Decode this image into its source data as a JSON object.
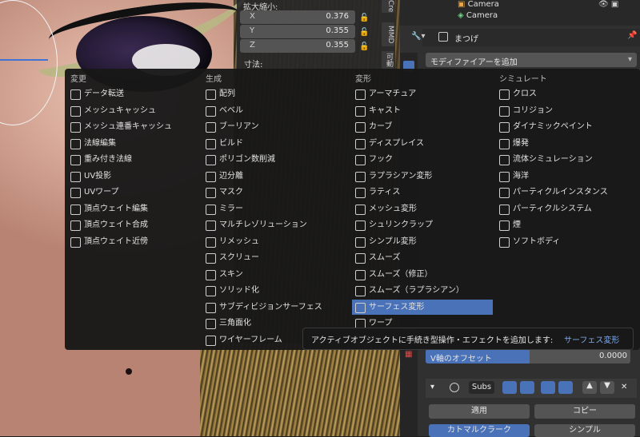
{
  "transform_panel": {
    "scale_label": "拡大縮小:",
    "dimensions_label": "寸法:",
    "scale": [
      {
        "axis": "X",
        "value": "0.376"
      },
      {
        "axis": "Y",
        "value": "0.355"
      },
      {
        "axis": "Z",
        "value": "0.355"
      }
    ],
    "side_tabs": [
      "Cre",
      "MMD",
      "可動"
    ]
  },
  "outliner": {
    "items": [
      "Camera",
      "Camera"
    ]
  },
  "properties": {
    "object_name": "まつげ",
    "add_modifier": "モディファイアーを追加",
    "v_offset_label": "V軸のオフセット",
    "v_offset_value": "0.0000",
    "modifier_name": "Subs",
    "apply_button": "適用",
    "copy_button": "コピー",
    "catmull_clark": "カトマルクラーク",
    "simple": "シンプル"
  },
  "menu": {
    "columns": [
      {
        "header": "変更",
        "items": [
          {
            "label": "データ転送",
            "icon": "data-transfer-icon"
          },
          {
            "label": "メッシュキャッシュ",
            "icon": "mesh-cache-icon"
          },
          {
            "label": "メッシュ連番キャッシュ",
            "icon": "mesh-sequence-cache-icon"
          },
          {
            "label": "法線編集",
            "icon": "normal-edit-icon"
          },
          {
            "label": "重み付き法線",
            "icon": "weighted-normal-icon"
          },
          {
            "label": "UV投影",
            "icon": "uv-project-icon"
          },
          {
            "label": "UVワープ",
            "icon": "uv-warp-icon"
          },
          {
            "label": "頂点ウェイト編集",
            "icon": "vertex-weight-edit-icon"
          },
          {
            "label": "頂点ウェイト合成",
            "icon": "vertex-weight-mix-icon"
          },
          {
            "label": "頂点ウェイト近傍",
            "icon": "vertex-weight-proximity-icon"
          }
        ]
      },
      {
        "header": "生成",
        "items": [
          {
            "label": "配列",
            "icon": "array-icon"
          },
          {
            "label": "ベベル",
            "icon": "bevel-icon"
          },
          {
            "label": "ブーリアン",
            "icon": "boolean-icon"
          },
          {
            "label": "ビルド",
            "icon": "build-icon"
          },
          {
            "label": "ポリゴン数削減",
            "icon": "decimate-icon"
          },
          {
            "label": "辺分離",
            "icon": "edge-split-icon"
          },
          {
            "label": "マスク",
            "icon": "mask-icon"
          },
          {
            "label": "ミラー",
            "icon": "mirror-icon"
          },
          {
            "label": "マルチレゾリューション",
            "icon": "multires-icon"
          },
          {
            "label": "リメッシュ",
            "icon": "remesh-icon"
          },
          {
            "label": "スクリュー",
            "icon": "screw-icon"
          },
          {
            "label": "スキン",
            "icon": "skin-icon"
          },
          {
            "label": "ソリッド化",
            "icon": "solidify-icon"
          },
          {
            "label": "サブディビジョンサーフェス",
            "icon": "subsurf-icon"
          },
          {
            "label": "三角面化",
            "icon": "triangulate-icon"
          },
          {
            "label": "ワイヤーフレーム",
            "icon": "wireframe-icon"
          }
        ]
      },
      {
        "header": "変形",
        "items": [
          {
            "label": "アーマチュア",
            "icon": "armature-icon"
          },
          {
            "label": "キャスト",
            "icon": "cast-icon"
          },
          {
            "label": "カーブ",
            "icon": "curve-icon"
          },
          {
            "label": "ディスプレイス",
            "icon": "displace-icon"
          },
          {
            "label": "フック",
            "icon": "hook-icon"
          },
          {
            "label": "ラプラシアン変形",
            "icon": "laplacian-deform-icon"
          },
          {
            "label": "ラティス",
            "icon": "lattice-icon"
          },
          {
            "label": "メッシュ変形",
            "icon": "mesh-deform-icon"
          },
          {
            "label": "シュリンクラップ",
            "icon": "shrinkwrap-icon"
          },
          {
            "label": "シンプル変形",
            "icon": "simple-deform-icon"
          },
          {
            "label": "スムーズ",
            "icon": "smooth-icon"
          },
          {
            "label": "スムーズ（修正）",
            "icon": "smooth-corrective-icon"
          },
          {
            "label": "スムーズ（ラプラシアン）",
            "icon": "smooth-laplacian-icon"
          },
          {
            "label": "サーフェス変形",
            "icon": "surface-deform-icon"
          },
          {
            "label": "ワープ",
            "icon": "warp-icon"
          }
        ]
      },
      {
        "header": "シミュレート",
        "items": [
          {
            "label": "クロス",
            "icon": "cloth-icon"
          },
          {
            "label": "コリジョン",
            "icon": "collision-icon"
          },
          {
            "label": "ダイナミックペイント",
            "icon": "dynamic-paint-icon"
          },
          {
            "label": "爆発",
            "icon": "explode-icon"
          },
          {
            "label": "流体シミュレーション",
            "icon": "fluid-icon"
          },
          {
            "label": "海洋",
            "icon": "ocean-icon"
          },
          {
            "label": "パーティクルインスタンス",
            "icon": "particle-instance-icon"
          },
          {
            "label": "パーティクルシステム",
            "icon": "particle-system-icon"
          },
          {
            "label": "煙",
            "icon": "smoke-icon"
          },
          {
            "label": "ソフトボディ",
            "icon": "soft-body-icon"
          }
        ]
      }
    ],
    "selected": "サーフェス変形"
  },
  "tooltip": {
    "text": "アクティブオブジェクトに手続き型操作・エフェクトを追加します: ",
    "highlight": "サーフェス変形"
  },
  "colors": {
    "accent": "#4a72b8",
    "tooltip_highlight": "#7fa8e8"
  }
}
